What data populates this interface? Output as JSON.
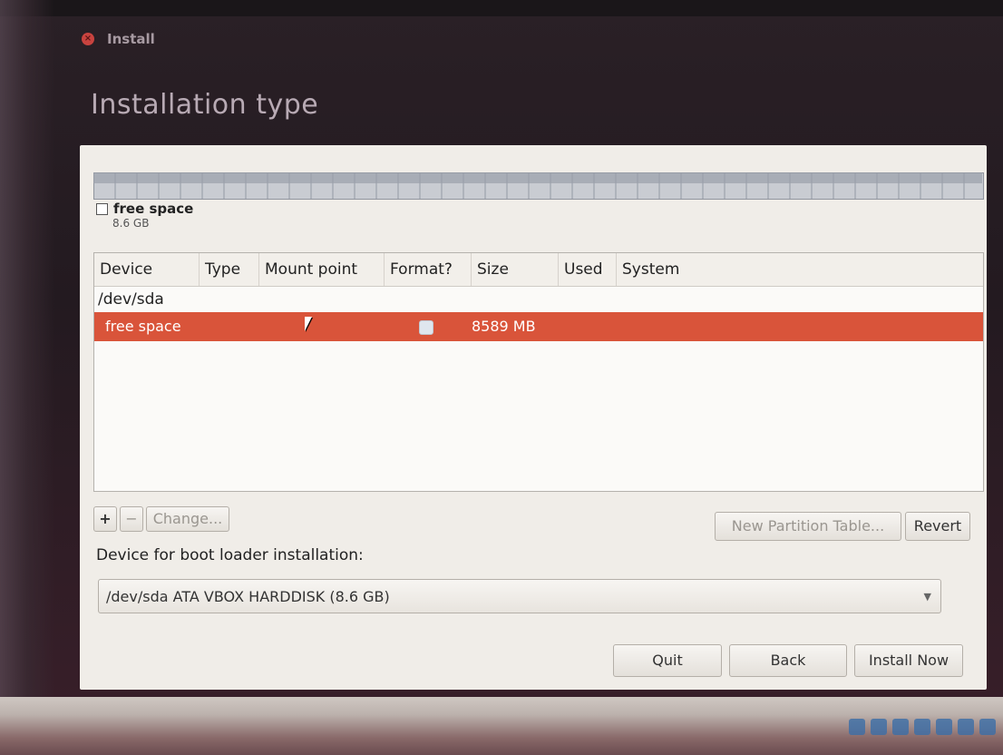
{
  "window": {
    "title": "Install"
  },
  "page": {
    "title": "Installation type"
  },
  "disk_legend": {
    "name": "free space",
    "size": "8.6 GB"
  },
  "partition_table": {
    "columns": [
      "Device",
      "Type",
      "Mount point",
      "Format?",
      "Size",
      "Used",
      "System"
    ],
    "device_row": "/dev/sda",
    "selected_row": {
      "device": "free space",
      "type": "",
      "mount_point": "",
      "format_checked": false,
      "size": "8589 MB",
      "used": "",
      "system": ""
    }
  },
  "partition_actions": {
    "add": "+",
    "remove": "−",
    "change": "Change...",
    "new_table": "New Partition Table...",
    "revert": "Revert"
  },
  "boot_loader": {
    "label": "Device for boot loader installation:",
    "selected": "/dev/sda  ATA VBOX HARDDISK (8.6 GB)"
  },
  "buttons": {
    "quit": "Quit",
    "back": "Back",
    "install_now": "Install Now"
  },
  "colors": {
    "accent": "#d9543a",
    "panel": "#f0ede8"
  },
  "tray_icons": [
    "harddisk-icon",
    "cdrom-icon",
    "usb-icon",
    "network-icon",
    "folder-icon",
    "display-icon",
    "mouse-icon"
  ]
}
